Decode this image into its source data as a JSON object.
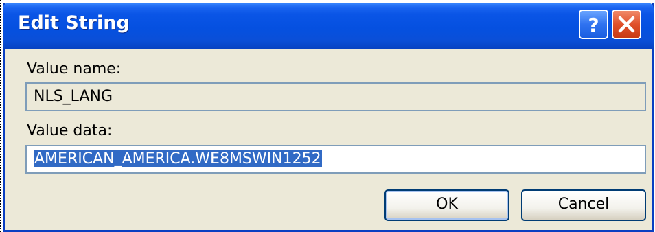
{
  "dialog": {
    "title": "Edit String"
  },
  "titlebar": {
    "help_icon": "question-mark-icon",
    "close_icon": "close-x-icon"
  },
  "value_name": {
    "label": "Value name:",
    "value": "NLS_LANG"
  },
  "value_data": {
    "label": "Value data:",
    "value": "AMERICAN_AMERICA.WE8MSWIN1252"
  },
  "buttons": {
    "ok_label": "OK",
    "cancel_label": "Cancel"
  },
  "colors": {
    "titlebar_blue": "#0550e0",
    "dialog_background": "#ece9d8",
    "selection_highlight": "#316ac5",
    "close_button_red": "#e0502a"
  }
}
